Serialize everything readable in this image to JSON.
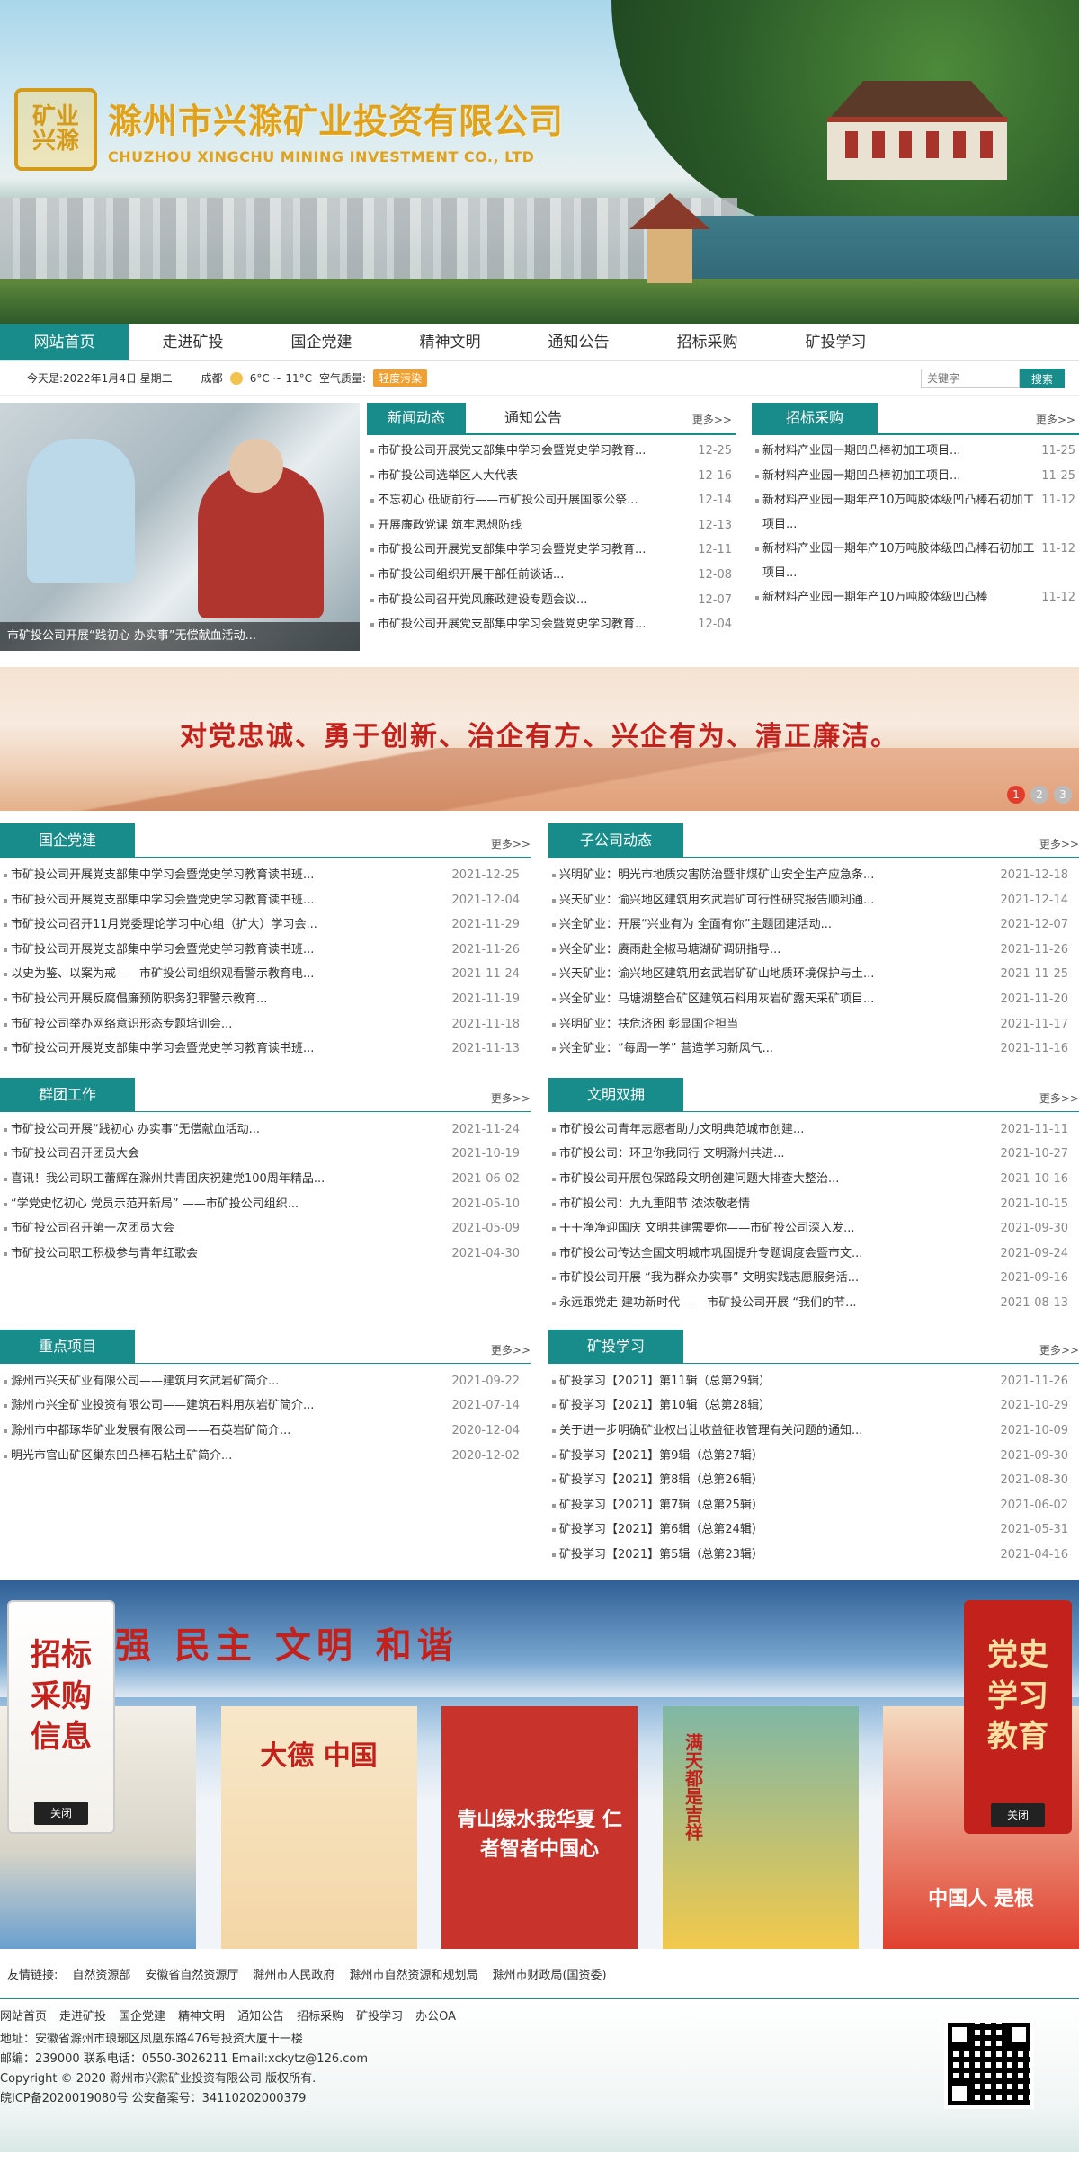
{
  "header": {
    "company_cn": "滁州市兴滁矿业投资有限公司",
    "company_en": "CHUZHOU XINGCHU MINING INVESTMENT CO., LTD",
    "logo_glyph_1": "矿业",
    "logo_glyph_2": "兴滁"
  },
  "nav": [
    "网站首页",
    "走进矿投",
    "国企党建",
    "精神文明",
    "通知公告",
    "招标采购",
    "矿投学习"
  ],
  "infobar": {
    "date": "今天是:2022年1月4日 星期二",
    "city": "成都",
    "temp": "6°C ~ 11°C",
    "aq_label": "空气质量:",
    "aq_value": "轻度污染",
    "search_placeholder": "关键字",
    "search_button": "搜索"
  },
  "slide": {
    "caption": "市矿投公司开展“践初心 办实事”无偿献血活动..."
  },
  "news": {
    "tab_active": "新闻动态",
    "tab_other": "通知公告",
    "more": "更多>>",
    "items": [
      {
        "t": "市矿投公司开展党支部集中学习会暨党史学习教育...",
        "d": "12-25"
      },
      {
        "t": "市矿投公司选举区人大代表",
        "d": "12-16"
      },
      {
        "t": "不忘初心 砥砺前行——市矿投公司开展国家公祭...",
        "d": "12-14"
      },
      {
        "t": "开展廉政党课 筑牢思想防线",
        "d": "12-13"
      },
      {
        "t": "市矿投公司开展党支部集中学习会暨党史学习教育...",
        "d": "12-11"
      },
      {
        "t": "市矿投公司组织开展干部任前谈话...",
        "d": "12-08"
      },
      {
        "t": "市矿投公司召开党风廉政建设专题会议...",
        "d": "12-07"
      },
      {
        "t": "市矿投公司开展党支部集中学习会暨党史学习教育...",
        "d": "12-04"
      }
    ]
  },
  "bid": {
    "title": "招标采购",
    "more": "更多>>",
    "items": [
      {
        "t": "新材料产业园一期凹凸棒初加工项目...",
        "d": "11-25"
      },
      {
        "t": "新材料产业园一期凹凸棒初加工项目...",
        "d": "11-25"
      },
      {
        "t": "新材料产业园一期年产10万吨胶体级凹凸棒石初加工项目...",
        "d": "11-12"
      },
      {
        "t": "新材料产业园一期年产10万吨胶体级凹凸棒石初加工项目...",
        "d": "11-12"
      },
      {
        "t": "新材料产业园一期年产10万吨胶体级凹凸棒",
        "d": "11-12"
      }
    ]
  },
  "motto": {
    "text": "对党忠诚、勇于创新、治企有方、兴企有为、清正廉洁。",
    "dots": [
      "1",
      "2",
      "3"
    ]
  },
  "sections": {
    "dangjian": {
      "title": "国企党建",
      "more": "更多>>",
      "items": [
        {
          "t": "市矿投公司开展党支部集中学习会暨党史学习教育读书班...",
          "d": "2021-12-25"
        },
        {
          "t": "市矿投公司开展党支部集中学习会暨党史学习教育读书班...",
          "d": "2021-12-04"
        },
        {
          "t": "市矿投公司召开11月党委理论学习中心组（扩大）学习会...",
          "d": "2021-11-29"
        },
        {
          "t": "市矿投公司开展党支部集中学习会暨党史学习教育读书班...",
          "d": "2021-11-26"
        },
        {
          "t": "以史为鉴、以案为戒——市矿投公司组织观看警示教育电...",
          "d": "2021-11-24"
        },
        {
          "t": "市矿投公司开展反腐倡廉预防职务犯罪警示教育...",
          "d": "2021-11-19"
        },
        {
          "t": "市矿投公司举办网络意识形态专题培训会...",
          "d": "2021-11-18"
        },
        {
          "t": "市矿投公司开展党支部集中学习会暨党史学习教育读书班...",
          "d": "2021-11-13"
        }
      ]
    },
    "zigongsi": {
      "title": "子公司动态",
      "more": "更多>>",
      "items": [
        {
          "t": "兴明矿业：明光市地质灾害防治暨非煤矿山安全生产应急条...",
          "d": "2021-12-18"
        },
        {
          "t": "兴天矿业：谕兴地区建筑用玄武岩矿可行性研究报告顺利通...",
          "d": "2021-12-14"
        },
        {
          "t": "兴全矿业：开展“兴业有为 全面有你”主题团建活动...",
          "d": "2021-12-07"
        },
        {
          "t": "兴全矿业：赓雨赴全椒马塘湖矿调研指导...",
          "d": "2021-11-26"
        },
        {
          "t": "兴天矿业：谕兴地区建筑用玄武岩矿矿山地质环境保护与土...",
          "d": "2021-11-25"
        },
        {
          "t": "兴全矿业：马塘湖整合矿区建筑石料用灰岩矿露天采矿项目...",
          "d": "2021-11-20"
        },
        {
          "t": "兴明矿业：扶危济困 彰显国企担当",
          "d": "2021-11-17"
        },
        {
          "t": "兴全矿业：“每周一学” 营造学习新风气...",
          "d": "2021-11-16"
        }
      ]
    },
    "quntuan": {
      "title": "群团工作",
      "more": "更多>>",
      "items": [
        {
          "t": "市矿投公司开展“践初心 办实事”无偿献血活动...",
          "d": "2021-11-24"
        },
        {
          "t": "市矿投公司召开团员大会",
          "d": "2021-10-19"
        },
        {
          "t": "喜讯！我公司职工蕾辉在滁州共青团庆祝建党100周年精品...",
          "d": "2021-06-02"
        },
        {
          "t": "“学党史忆初心 党员示范开新局” ——市矿投公司组织...",
          "d": "2021-05-10"
        },
        {
          "t": "市矿投公司召开第一次团员大会",
          "d": "2021-05-09"
        },
        {
          "t": "市矿投公司职工积极参与青年红歌会",
          "d": "2021-04-30"
        }
      ]
    },
    "wenming": {
      "title": "文明双拥",
      "more": "更多>>",
      "items": [
        {
          "t": "市矿投公司青年志愿者助力文明典范城市创建...",
          "d": "2021-11-11"
        },
        {
          "t": "市矿投公司：环卫你我同行 文明滁州共进...",
          "d": "2021-10-27"
        },
        {
          "t": "市矿投公司开展包保路段文明创建问题大排查大整治...",
          "d": "2021-10-16"
        },
        {
          "t": "市矿投公司：九九重阳节 浓浓敬老情",
          "d": "2021-10-15"
        },
        {
          "t": "干干净净迎国庆 文明共建需要你——市矿投公司深入发...",
          "d": "2021-09-30"
        },
        {
          "t": "市矿投公司传达全国文明城市巩固提升专题调度会暨市文...",
          "d": "2021-09-24"
        },
        {
          "t": "市矿投公司开展 “我为群众办实事” 文明实践志愿服务活...",
          "d": "2021-09-16"
        },
        {
          "t": "永远跟党走 建功新时代 ——市矿投公司开展 “我们的节...",
          "d": "2021-08-13"
        }
      ]
    },
    "zhongdian": {
      "title": "重点项目",
      "more": "更多>>",
      "items": [
        {
          "t": "滁州市兴天矿业有限公司——建筑用玄武岩矿简介...",
          "d": "2021-09-22"
        },
        {
          "t": "滁州市兴全矿业投资有限公司——建筑石料用灰岩矿简介...",
          "d": "2021-07-14"
        },
        {
          "t": "滁州市中都琢华矿业发展有限公司——石英岩矿简介...",
          "d": "2020-12-04"
        },
        {
          "t": "明光市官山矿区巢东凹凸棒石粘土矿简介...",
          "d": "2020-12-02"
        }
      ]
    },
    "xuexi": {
      "title": "矿投学习",
      "more": "更多>>",
      "items": [
        {
          "t": "矿投学习【2021】第11辑（总第29辑）",
          "d": "2021-11-26"
        },
        {
          "t": "矿投学习【2021】第10辑（总第28辑）",
          "d": "2021-10-29"
        },
        {
          "t": "关于进一步明确矿业权出让收益征收管理有关问题的通知...",
          "d": "2021-10-09"
        },
        {
          "t": "矿投学习【2021】第9辑（总第27辑）",
          "d": "2021-09-30"
        },
        {
          "t": "矿投学习【2021】第8辑（总第26辑）",
          "d": "2021-08-30"
        },
        {
          "t": "矿投学习【2021】第7辑（总第25辑）",
          "d": "2021-06-02"
        },
        {
          "t": "矿投学习【2021】第6辑（总第24辑）",
          "d": "2021-05-31"
        },
        {
          "t": "矿投学习【2021】第5辑（总第23辑）",
          "d": "2021-04-16"
        }
      ]
    }
  },
  "bottom_banner": {
    "slogan": "强 民主 文明 和谐",
    "posters": [
      "",
      "大德 中国",
      "青山绿水我华夏 仁者智者中国心",
      "满天都是吉祥",
      "中国人 是根"
    ],
    "float_left": {
      "text": "招标采购信息",
      "close": "关闭"
    },
    "float_right": {
      "text": "党史学习教育",
      "close": "关闭"
    }
  },
  "friends": {
    "label": "友情链接:",
    "links": [
      "自然资源部",
      "安徽省自然资源厅",
      "滁州市人民政府",
      "滁州市自然资源和规划局",
      "滁州市财政局(国资委)"
    ]
  },
  "footer": {
    "nav": [
      "网站首页",
      "走进矿投",
      "国企党建",
      "精神文明",
      "通知公告",
      "招标采购",
      "矿投学习",
      "办公OA"
    ],
    "address": "地址：安徽省滁州市琅琊区凤凰东路476号投资大厦十一楼",
    "contact": "邮编：239000   联系电话：0550-3026211 Email:xckytz@126.com",
    "copyright": "Copyright © 2020 滁州市兴滁矿业投资有限公司 版权所有.",
    "icp": "皖ICP备2020019080号 公安备案号：34110202000379"
  }
}
